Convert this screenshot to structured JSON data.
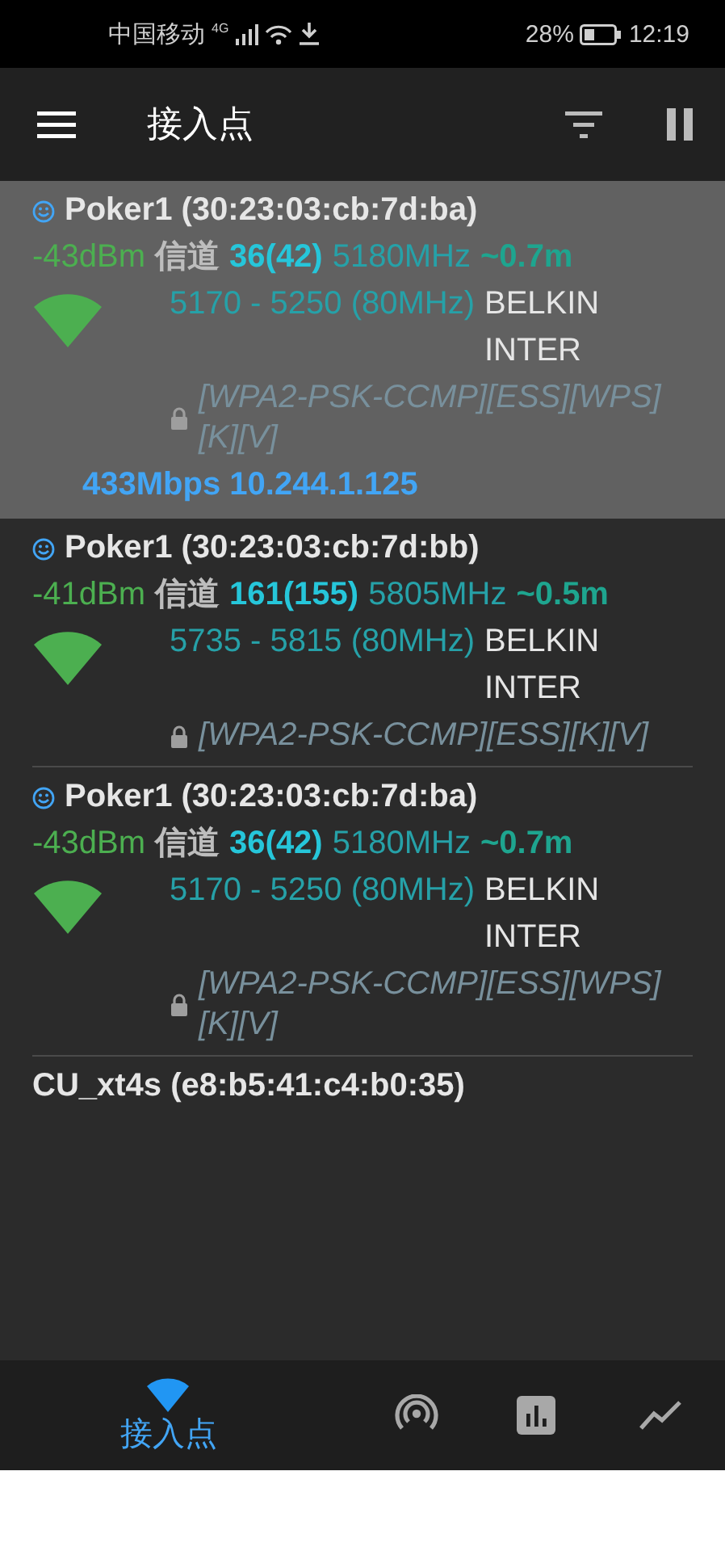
{
  "status_bar": {
    "carrier": "中国移动",
    "network": "4G",
    "battery": "28%",
    "time": "12:19"
  },
  "toolbar": {
    "title": "接入点"
  },
  "access_points": [
    {
      "name": "Poker1 (30:23:03:cb:7d:ba)",
      "selected": true,
      "signal": "-43dBm",
      "channel_label": "信道",
      "channel": "36(42)",
      "frequency": "5180MHz",
      "distance": "~0.7m",
      "range": "5170 - 5250 (80MHz)",
      "vendor": "BELKIN INTER",
      "security": "[WPA2-PSK-CCMP][ESS][WPS][K][V]",
      "link": "433Mbps 10.244.1.125"
    },
    {
      "name": "Poker1 (30:23:03:cb:7d:bb)",
      "selected": false,
      "signal": "-41dBm",
      "channel_label": "信道",
      "channel": "161(155)",
      "frequency": "5805MHz",
      "distance": "~0.5m",
      "range": "5735 - 5815 (80MHz)",
      "vendor": "BELKIN INTER",
      "security": "[WPA2-PSK-CCMP][ESS][K][V]"
    },
    {
      "name": "Poker1 (30:23:03:cb:7d:ba)",
      "selected": false,
      "signal": "-43dBm",
      "channel_label": "信道",
      "channel": "36(42)",
      "frequency": "5180MHz",
      "distance": "~0.7m",
      "range": "5170 - 5250 (80MHz)",
      "vendor": "BELKIN INTER",
      "security": "[WPA2-PSK-CCMP][ESS][WPS][K][V]"
    },
    {
      "name": "CU_xt4s (e8:b5:41:c4:b0:35)",
      "selected": false
    }
  ],
  "bottom_nav": [
    {
      "label": "接入点",
      "selected": true
    },
    {
      "selected": false
    },
    {
      "selected": false
    },
    {
      "selected": false
    }
  ]
}
